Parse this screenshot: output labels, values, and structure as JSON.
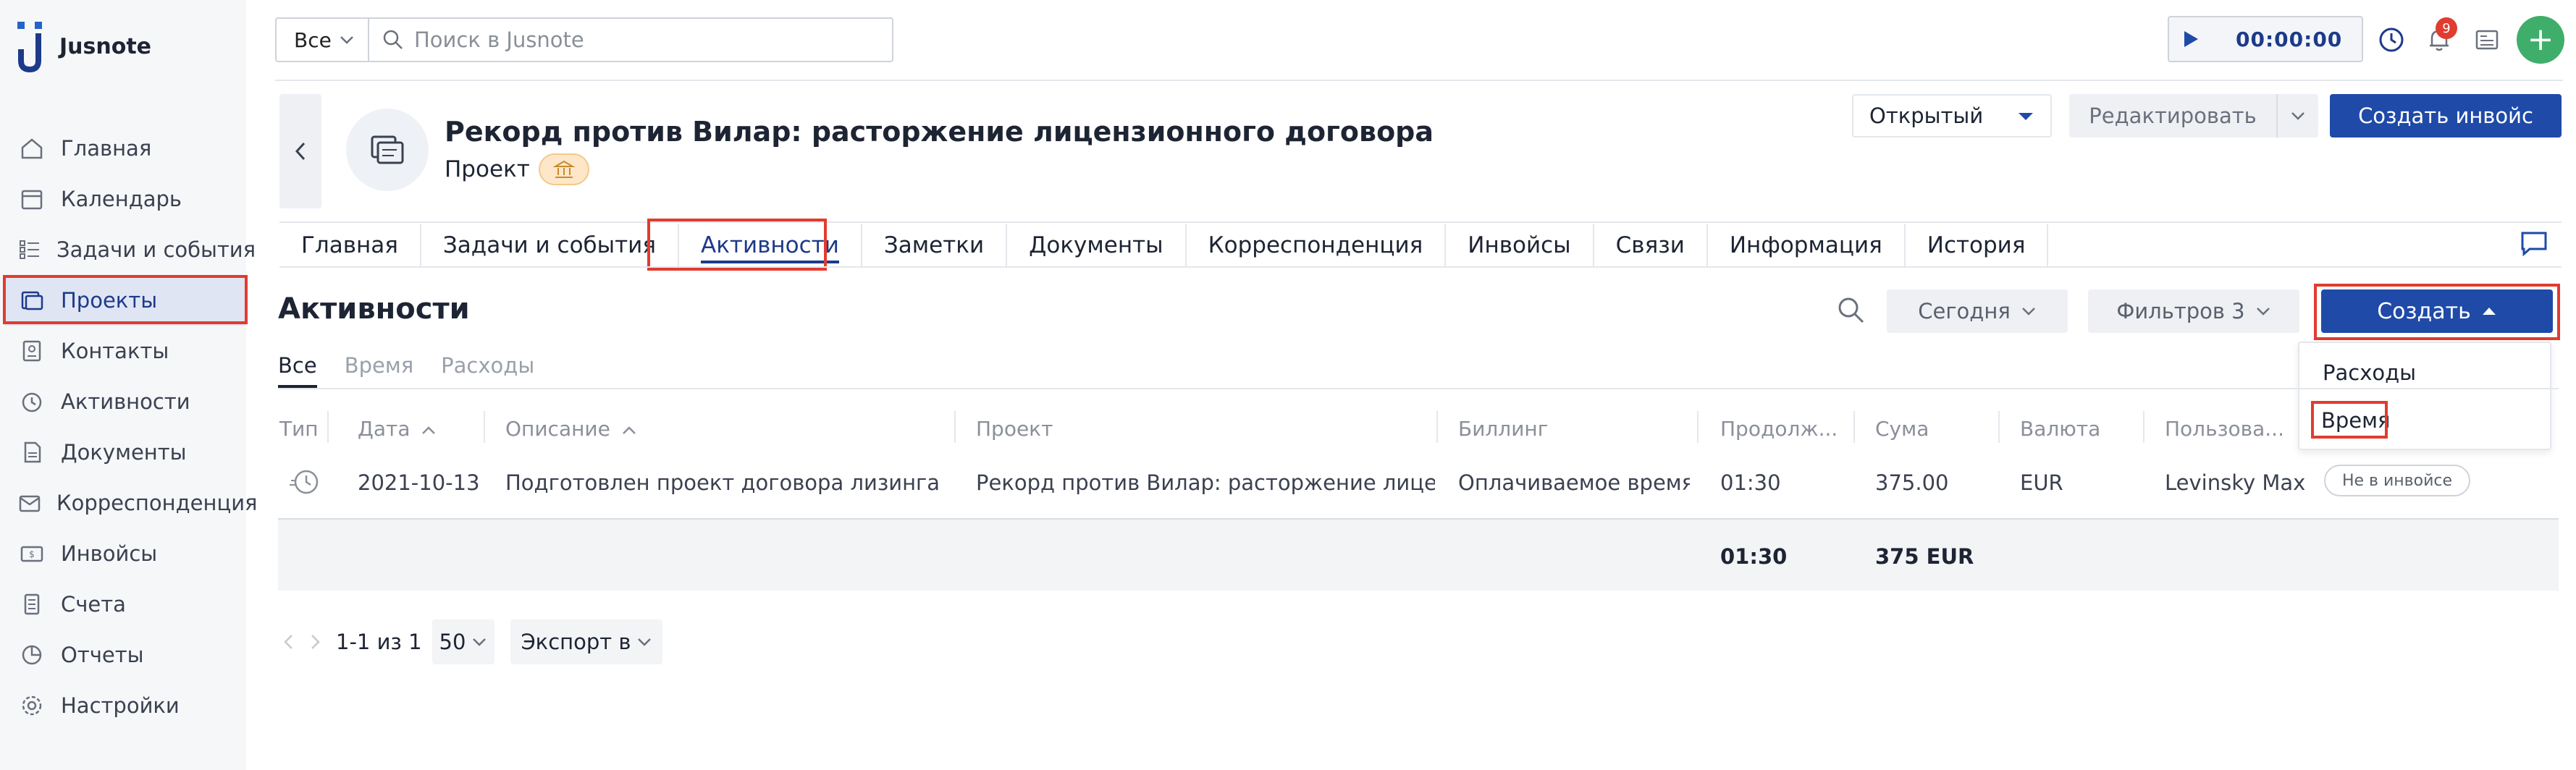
{
  "app": {
    "name": "Jusnote"
  },
  "sidebar": {
    "items": [
      {
        "label": "Главная",
        "icon": "home-icon"
      },
      {
        "label": "Календарь",
        "icon": "calendar-icon"
      },
      {
        "label": "Задачи и события",
        "icon": "tasks-icon"
      },
      {
        "label": "Проекты",
        "icon": "projects-icon",
        "active": true
      },
      {
        "label": "Контакты",
        "icon": "contacts-icon"
      },
      {
        "label": "Активности",
        "icon": "activities-icon"
      },
      {
        "label": "Документы",
        "icon": "documents-icon"
      },
      {
        "label": "Корреспонденция",
        "icon": "correspondence-icon"
      },
      {
        "label": "Инвойсы",
        "icon": "invoices-icon"
      },
      {
        "label": "Счета",
        "icon": "accounts-icon"
      },
      {
        "label": "Отчеты",
        "icon": "reports-icon"
      },
      {
        "label": "Настройки",
        "icon": "settings-icon"
      }
    ]
  },
  "topbar": {
    "scope": "Все",
    "search_placeholder": "Поиск в Jusnote",
    "timer": "00:00:00",
    "notifications_count": "9"
  },
  "project": {
    "title": "Рекорд против Вилар: расторжение лицензионного договора",
    "subtitle": "Проект",
    "status": "Открытый",
    "edit_label": "Редактировать",
    "invoice_label": "Создать инвойс"
  },
  "tabs": [
    "Главная",
    "Задачи и события",
    "Активности",
    "Заметки",
    "Документы",
    "Корреспонденция",
    "Инвойсы",
    "Связи",
    "Информация",
    "История"
  ],
  "activities": {
    "title": "Активности",
    "today": "Сегодня",
    "filters": "Фильтров 3",
    "create": "Создать",
    "menu": [
      "Расходы",
      "Время"
    ],
    "subtabs": [
      "Все",
      "Время",
      "Расходы"
    ],
    "columns": [
      "Тип",
      "Дата",
      "Описание",
      "Проект",
      "Биллинг",
      "Продолж...",
      "Сума",
      "Валюта",
      "Пользова..."
    ],
    "rows": [
      {
        "date": "2021-10-13",
        "description": "Подготовлен проект договора лизинга",
        "project": "Рекорд против Вилар: расторжение лицензионного договора",
        "billing": "Оплачиваемое время",
        "duration": "01:30",
        "sum": "375.00",
        "currency": "EUR",
        "user": "Levinsky Max",
        "status": "Не в инвойсе"
      }
    ],
    "totals": {
      "duration": "01:30",
      "sum": "375 EUR"
    }
  },
  "pager": {
    "range": "1-1 из 1",
    "per_page": "50",
    "export": "Экспорт в"
  },
  "colors": {
    "accent": "#1f4aa8",
    "highlight": "#e03c2f",
    "add": "#3fae6a"
  }
}
